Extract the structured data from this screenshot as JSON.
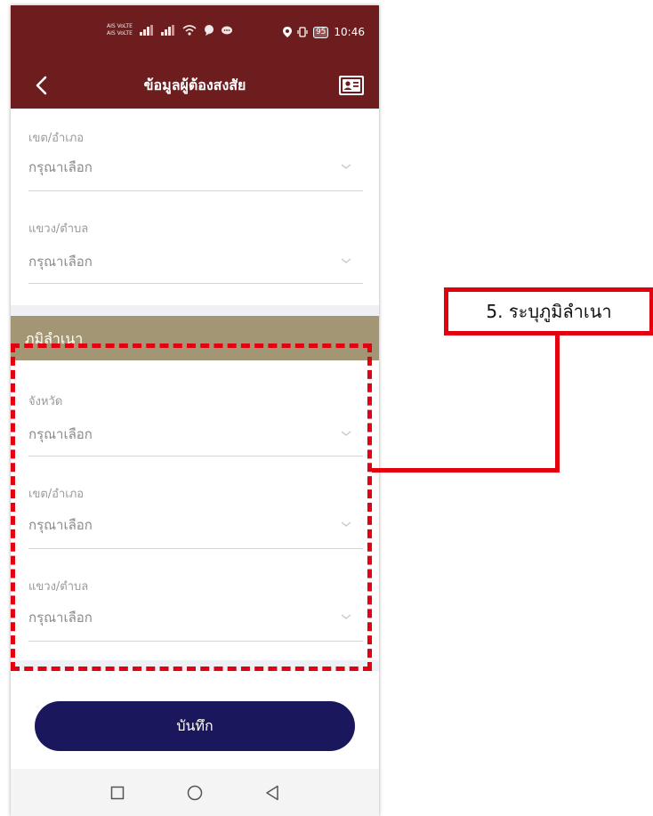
{
  "status_bar": {
    "carrier_top": "AIS VoLTE",
    "carrier_bottom": "AIS VoLTE",
    "battery": "95",
    "time": "10:46"
  },
  "app_bar": {
    "title": "ข้อมูลผู้ต้องสงสัย",
    "back_icon": "chevron-left-icon",
    "right_icon": "id-card-icon"
  },
  "address_fields": [
    {
      "label": "เขต/อำเภอ",
      "placeholder": "กรุณาเลือก"
    },
    {
      "label": "แขวง/ตำบล",
      "placeholder": "กรุณาเลือก"
    }
  ],
  "hometown_section": {
    "title": "ภูมิลำเนา",
    "fields": [
      {
        "label": "จังหวัด",
        "placeholder": "กรุณาเลือก"
      },
      {
        "label": "เขต/อำเภอ",
        "placeholder": "กรุณาเลือก"
      },
      {
        "label": "แขวง/ตำบล",
        "placeholder": "กรุณาเลือก"
      }
    ]
  },
  "save_button": {
    "label": "บันทึก"
  },
  "callout": {
    "text": "5. ระบุภูมิลำเนา"
  },
  "colors": {
    "header": "#6e1d1e",
    "section_header": "#a29675",
    "save_button": "#1b175c",
    "annotation": "#e3000f"
  }
}
